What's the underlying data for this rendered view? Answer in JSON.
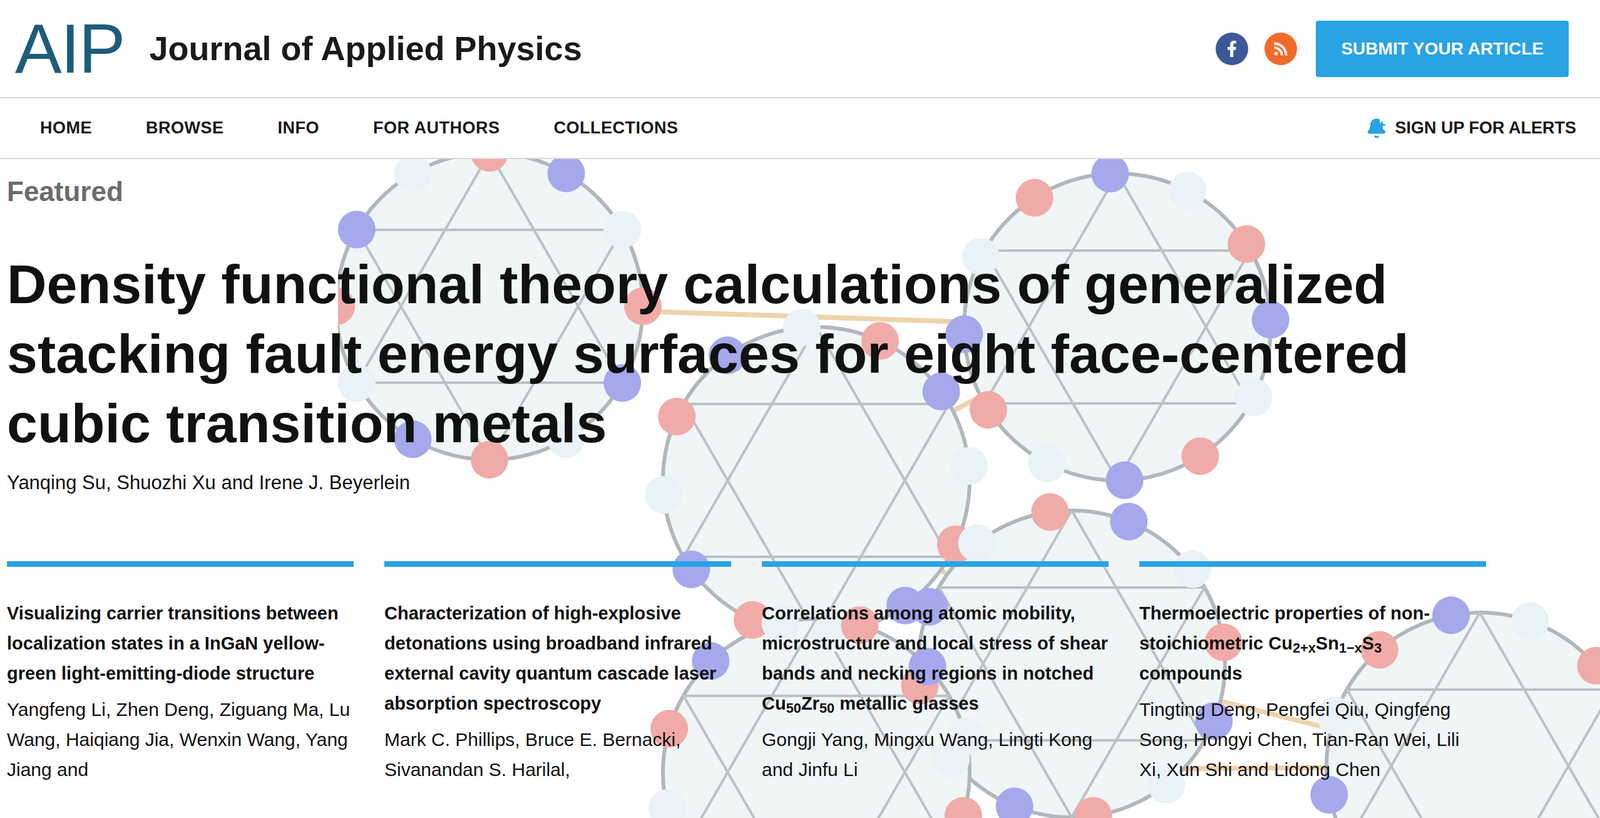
{
  "header": {
    "logo": "AIP",
    "journal": "Journal of Applied Physics",
    "submit_button": "SUBMIT YOUR ARTICLE"
  },
  "nav": {
    "items": [
      {
        "label": "HOME"
      },
      {
        "label": "BROWSE"
      },
      {
        "label": "INFO"
      },
      {
        "label": "FOR AUTHORS"
      },
      {
        "label": "COLLECTIONS"
      }
    ],
    "alerts": "SIGN UP FOR ALERTS"
  },
  "featured": {
    "label": "Featured",
    "title": "Density functional theory calculations of generalized stacking fault energy surfaces for eight face-centered cubic transition metals",
    "authors": "Yanqing Su, Shuozhi Xu and Irene J. Beyerlein"
  },
  "articles": [
    {
      "title": [
        {
          "text": "Visualizing carrier transitions between localization states in a InGaN yellow-green light-emitting-diode structure",
          "sub": false
        }
      ],
      "authors": "Yangfeng Li, Zhen Deng, Ziguang Ma, Lu Wang, Haiqiang Jia, Wenxin Wang, Yang Jiang and"
    },
    {
      "title": [
        {
          "text": "Characterization of high-explosive detonations using broadband infrared external cavity quantum cascade laser absorption spectroscopy",
          "sub": false
        }
      ],
      "authors": "Mark C. Phillips, Bruce E. Bernacki, Sivanandan S. Harilal,"
    },
    {
      "title": [
        {
          "text": "Correlations among atomic mobility, microstructure and local stress of shear bands and necking regions in notched Cu",
          "sub": false
        },
        {
          "text": "50",
          "sub": true
        },
        {
          "text": "Zr",
          "sub": false
        },
        {
          "text": "50",
          "sub": true
        },
        {
          "text": " metallic glasses",
          "sub": false
        }
      ],
      "authors": "Gongji Yang, Mingxu Wang, Lingti Kong and Jinfu Li"
    },
    {
      "title": [
        {
          "text": "Thermoelectric properties of non-stoichiometric Cu",
          "sub": false
        },
        {
          "text": "2+x",
          "sub": true
        },
        {
          "text": "Sn",
          "sub": false
        },
        {
          "text": "1−x",
          "sub": true
        },
        {
          "text": "S",
          "sub": false
        },
        {
          "text": "3",
          "sub": true
        },
        {
          "text": " compounds",
          "sub": false
        }
      ],
      "authors": "Tingting Deng, Pengfei Qiu, Qingfeng Song, Hongyi Chen, Tian-Ran Wei, Lili Xi, Xun Shi and Lidong Chen"
    }
  ]
}
